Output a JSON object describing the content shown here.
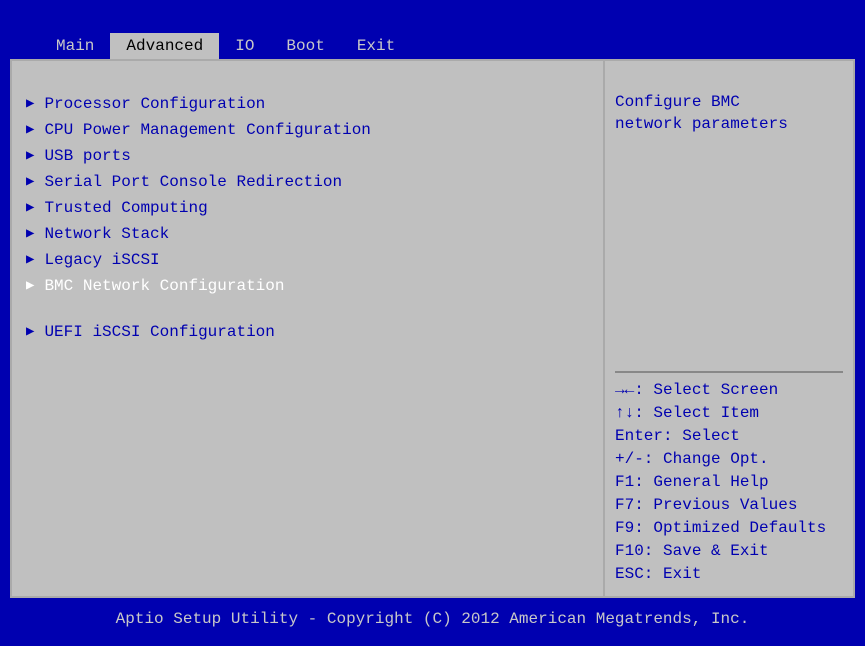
{
  "tabs": [
    {
      "label": "Main",
      "active": false
    },
    {
      "label": "Advanced",
      "active": true
    },
    {
      "label": "IO",
      "active": false
    },
    {
      "label": "Boot",
      "active": false
    },
    {
      "label": "Exit",
      "active": false
    }
  ],
  "menu": {
    "items": [
      {
        "label": "Processor Configuration",
        "selected": false
      },
      {
        "label": "CPU Power Management Configuration",
        "selected": false
      },
      {
        "label": "USB ports",
        "selected": false
      },
      {
        "label": "Serial Port Console Redirection",
        "selected": false
      },
      {
        "label": "Trusted Computing",
        "selected": false
      },
      {
        "label": "Network Stack",
        "selected": false
      },
      {
        "label": "Legacy iSCSI",
        "selected": false
      },
      {
        "label": "BMC Network Configuration",
        "selected": true
      }
    ],
    "group2": [
      {
        "label": "UEFI iSCSI Configuration",
        "selected": false
      }
    ]
  },
  "help": {
    "desc_line1": "Configure BMC",
    "desc_line2": "network parameters",
    "keys": {
      "k1": "→←: Select Screen",
      "k2": "↑↓: Select Item",
      "k3": "Enter: Select",
      "k4": "+/-: Change Opt.",
      "k5": "F1: General Help",
      "k6": "F7: Previous Values",
      "k7": "F9: Optimized Defaults",
      "k8": "F10: Save & Exit",
      "k9": "ESC: Exit"
    }
  },
  "footer": {
    "text": "Aptio Setup Utility - Copyright (C) 2012 American Megatrends, Inc."
  }
}
